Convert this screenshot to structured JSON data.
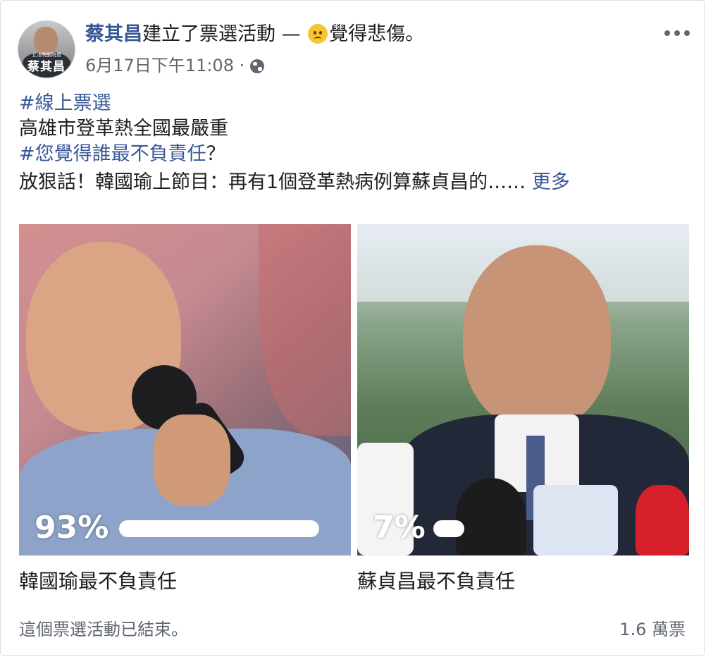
{
  "post": {
    "author": "蔡其昌",
    "action_before_feeling": "建立了票選活動 — ",
    "feeling": "覺得悲傷。",
    "feeling_icon": "sad-face-emoji",
    "timestamp": "6月17日下午11:08",
    "separator": " · ",
    "privacy_icon": "globe-icon",
    "avatar": {
      "name": "蔡其昌",
      "role": "立法院副院長"
    }
  },
  "body": {
    "hashtag1": "#線上票選",
    "line2": "高雄市登革熱全國最嚴重",
    "hashtag2": "#您覺得誰最不負責任",
    "hashtag2_suffix": "？",
    "line4": "放狠話！韓國瑜上節目：再有1個登革熱病例算蘇貞昌的……",
    "see_more": "更多"
  },
  "poll": {
    "options": [
      {
        "label": "韓國瑜最不負責任",
        "percent_text": "93%",
        "percent": 93
      },
      {
        "label": "蘇貞昌最不負責任",
        "percent_text": "7%",
        "percent": 7
      }
    ],
    "status": "這個票選活動已結束。",
    "total_votes": "1.6 萬票"
  },
  "colors": {
    "link": "#385898",
    "text": "#1c1e21",
    "secondary": "#606770"
  }
}
